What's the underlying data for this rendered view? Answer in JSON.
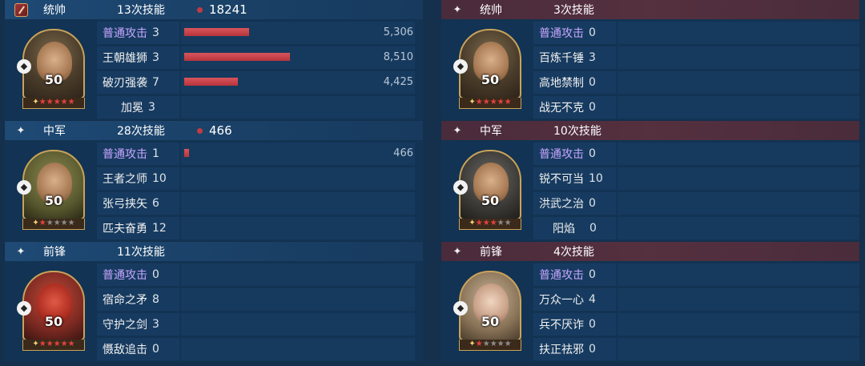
{
  "left": {
    "sections": [
      {
        "role": "统帅",
        "count": "13次技能",
        "total": "18241",
        "level": "50",
        "stars_red": 5,
        "stars_grey": 0,
        "skills": [
          {
            "name": "普通攻击",
            "num": "3",
            "value": "5,306",
            "fraction": 0.29
          },
          {
            "name": "王朝雄狮",
            "num": "3",
            "value": "8,510",
            "fraction": 0.47
          },
          {
            "name": "破刃强袭",
            "num": "7",
            "value": "4,425",
            "fraction": 0.24
          },
          {
            "name": "加冕",
            "num": "3",
            "value": "",
            "fraction": 0
          }
        ]
      },
      {
        "role": "中军",
        "count": "28次技能",
        "total": "466",
        "level": "50",
        "stars_red": 1,
        "stars_grey": 4,
        "skills": [
          {
            "name": "普通攻击",
            "num": "1",
            "value": "466",
            "fraction": 0.02
          },
          {
            "name": "王者之师",
            "num": "10",
            "value": "",
            "fraction": 0
          },
          {
            "name": "张弓挟矢",
            "num": "6",
            "value": "",
            "fraction": 0
          },
          {
            "name": "匹夫奋勇",
            "num": "12",
            "value": "",
            "fraction": 0
          }
        ]
      },
      {
        "role": "前锋",
        "count": "11次技能",
        "total": "",
        "level": "50",
        "stars_red": 5,
        "stars_grey": 0,
        "skills": [
          {
            "name": "普通攻击",
            "num": "0",
            "value": "",
            "fraction": 0
          },
          {
            "name": "宿命之矛",
            "num": "8",
            "value": "",
            "fraction": 0
          },
          {
            "name": "守护之剑",
            "num": "3",
            "value": "",
            "fraction": 0
          },
          {
            "name": "慑敌追击",
            "num": "0",
            "value": "",
            "fraction": 0
          }
        ]
      }
    ]
  },
  "right": {
    "sections": [
      {
        "role": "统帅",
        "count": "3次技能",
        "level": "50",
        "stars_red": 5,
        "stars_grey": 0,
        "skills": [
          {
            "name": "普通攻击",
            "num": "0"
          },
          {
            "name": "百炼千锤",
            "num": "3"
          },
          {
            "name": "高地禁制",
            "num": "0"
          },
          {
            "name": "战无不克",
            "num": "0"
          }
        ]
      },
      {
        "role": "中军",
        "count": "10次技能",
        "level": "50",
        "stars_red": 3,
        "stars_grey": 2,
        "skills": [
          {
            "name": "普通攻击",
            "num": "0"
          },
          {
            "name": "锐不可当",
            "num": "10"
          },
          {
            "name": "洪武之治",
            "num": "0"
          },
          {
            "name": "阳焰",
            "num": "0"
          }
        ]
      },
      {
        "role": "前锋",
        "count": "4次技能",
        "level": "50",
        "stars_red": 1,
        "stars_grey": 4,
        "skills": [
          {
            "name": "普通攻击",
            "num": "0"
          },
          {
            "name": "万众一心",
            "num": "4"
          },
          {
            "name": "兵不厌诈",
            "num": "0"
          },
          {
            "name": "扶正祛邪",
            "num": "0"
          }
        ]
      }
    ]
  },
  "icons": {
    "role_badge": "commander-badge-icon",
    "role_star": "four-point-star-icon",
    "troop_type": "troop-type-icon",
    "total_dot": "damage-dot-icon"
  },
  "colors": {
    "bar": "#c23b42",
    "basic_attack_text": "#c7a6ff",
    "left_header": "#1e4a75",
    "right_header": "#4a2b3b",
    "frame_gold": "#c9a35b"
  }
}
